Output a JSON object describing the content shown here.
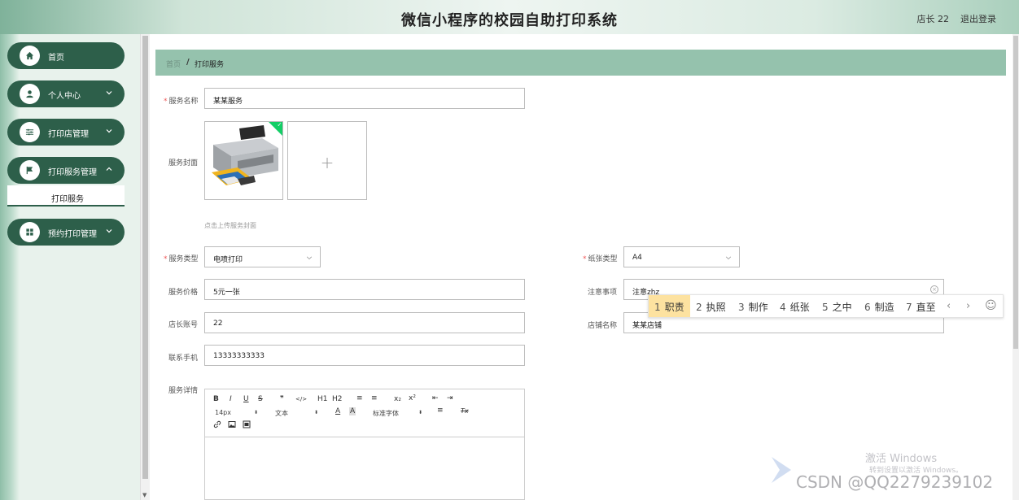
{
  "header": {
    "title": "微信小程序的校园自助打印系统",
    "user": "店长 22",
    "logout": "退出登录"
  },
  "sidebar": {
    "items": [
      {
        "label": "首页",
        "icon": "home-icon"
      },
      {
        "label": "个人中心",
        "icon": "user-icon"
      },
      {
        "label": "打印店管理",
        "icon": "sliders-icon"
      },
      {
        "label": "打印服务管理",
        "icon": "flag-icon"
      },
      {
        "label": "预约打印管理",
        "icon": "grid-icon"
      }
    ],
    "submenu_label": "打印服务"
  },
  "breadcrumb": {
    "home": "首页",
    "separator": "/",
    "current": "打印服务"
  },
  "form": {
    "service_name_label": "服务名称",
    "service_name_value": "某某服务",
    "cover_label": "服务封面",
    "cover_hint": "点击上传服务封面",
    "cover_add": "+",
    "service_type_label": "服务类型",
    "service_type_value": "电喷打印",
    "paper_type_label": "纸张类型",
    "paper_type_value": "A4",
    "price_label": "服务价格",
    "price_value": "5元一张",
    "notes_label": "注意事项",
    "notes_value": "注意zhz",
    "owner_account_label": "店长账号",
    "owner_account_value": "22",
    "shop_name_label": "店铺名称",
    "shop_name_value": "某某店铺",
    "phone_label": "联系手机",
    "phone_value": "13333333333",
    "detail_label": "服务详情"
  },
  "editor": {
    "row1": [
      "B",
      "I",
      "U",
      "S",
      "❞",
      "</>",
      "H1",
      "H2",
      "≡",
      "≡",
      "x₂",
      "x²",
      "⇤",
      "⇥"
    ],
    "font_size": "14px",
    "text_style": "文本",
    "font_family": "标准字体",
    "text_color_icon": "A",
    "bg_color_icon": "A",
    "align_icon": "≡",
    "clear_icon": "Tx"
  },
  "ime": {
    "candidates": [
      {
        "n": "1",
        "w": "职责"
      },
      {
        "n": "2",
        "w": "执照"
      },
      {
        "n": "3",
        "w": "制作"
      },
      {
        "n": "4",
        "w": "纸张"
      },
      {
        "n": "5",
        "w": "之中"
      },
      {
        "n": "6",
        "w": "制造"
      },
      {
        "n": "7",
        "w": "直至"
      }
    ],
    "prev": "‹",
    "next": "›",
    "emoji": "☺"
  },
  "watermark": {
    "windows1": "激活 Windows",
    "windows2": "转到设置以激活 Windows。",
    "csdn": "CSDN @QQ2279239102"
  }
}
